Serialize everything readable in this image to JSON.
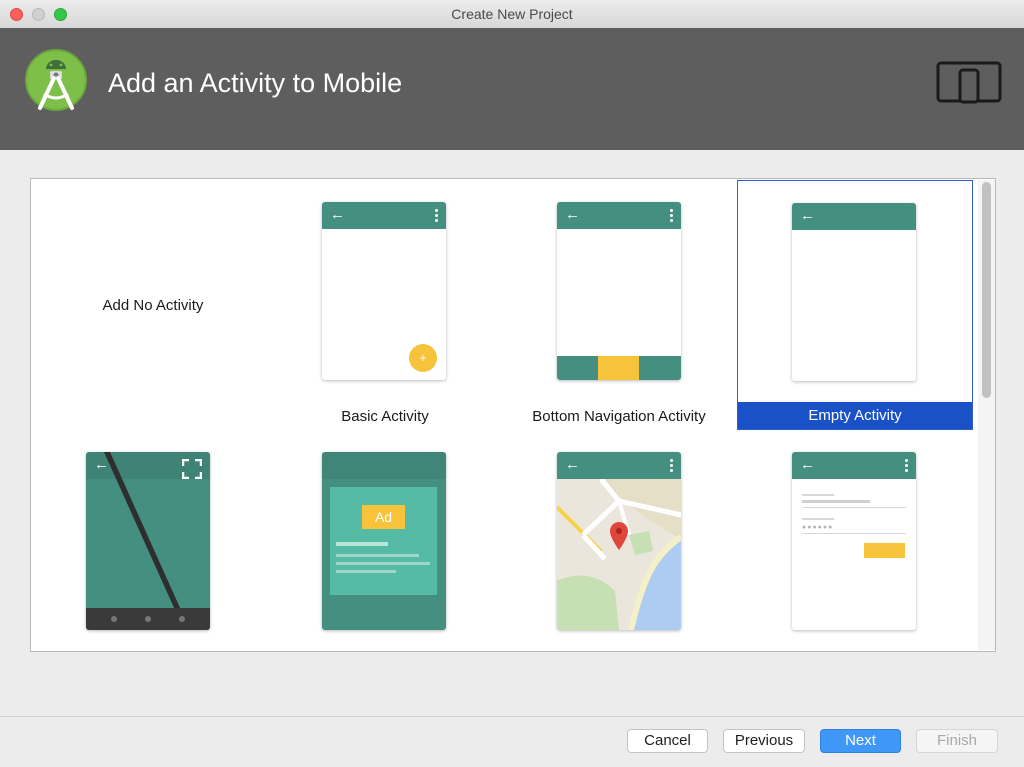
{
  "window": {
    "title": "Create New Project"
  },
  "header": {
    "title": "Add an Activity to Mobile",
    "logo_icon": "android-studio-logo-icon",
    "device_icon": "phone-tablet-icon"
  },
  "gallery": {
    "no_activity_label": "Add No Activity",
    "tiles": [
      {
        "label": "Basic Activity"
      },
      {
        "label": "Bottom Navigation Activity"
      },
      {
        "label": "Empty Activity",
        "selected": true
      },
      {
        "label": ""
      },
      {
        "label": ""
      },
      {
        "label": ""
      },
      {
        "label": ""
      }
    ],
    "ad_badge": "Ad"
  },
  "buttons": {
    "cancel": "Cancel",
    "previous": "Previous",
    "next": "Next",
    "finish": "Finish"
  },
  "colors": {
    "header_bg": "#5e5e5e",
    "teal": "#448f80",
    "accent_yellow": "#f6c33b",
    "selection_blue": "#1a51c7",
    "primary_button": "#3f97f7"
  }
}
